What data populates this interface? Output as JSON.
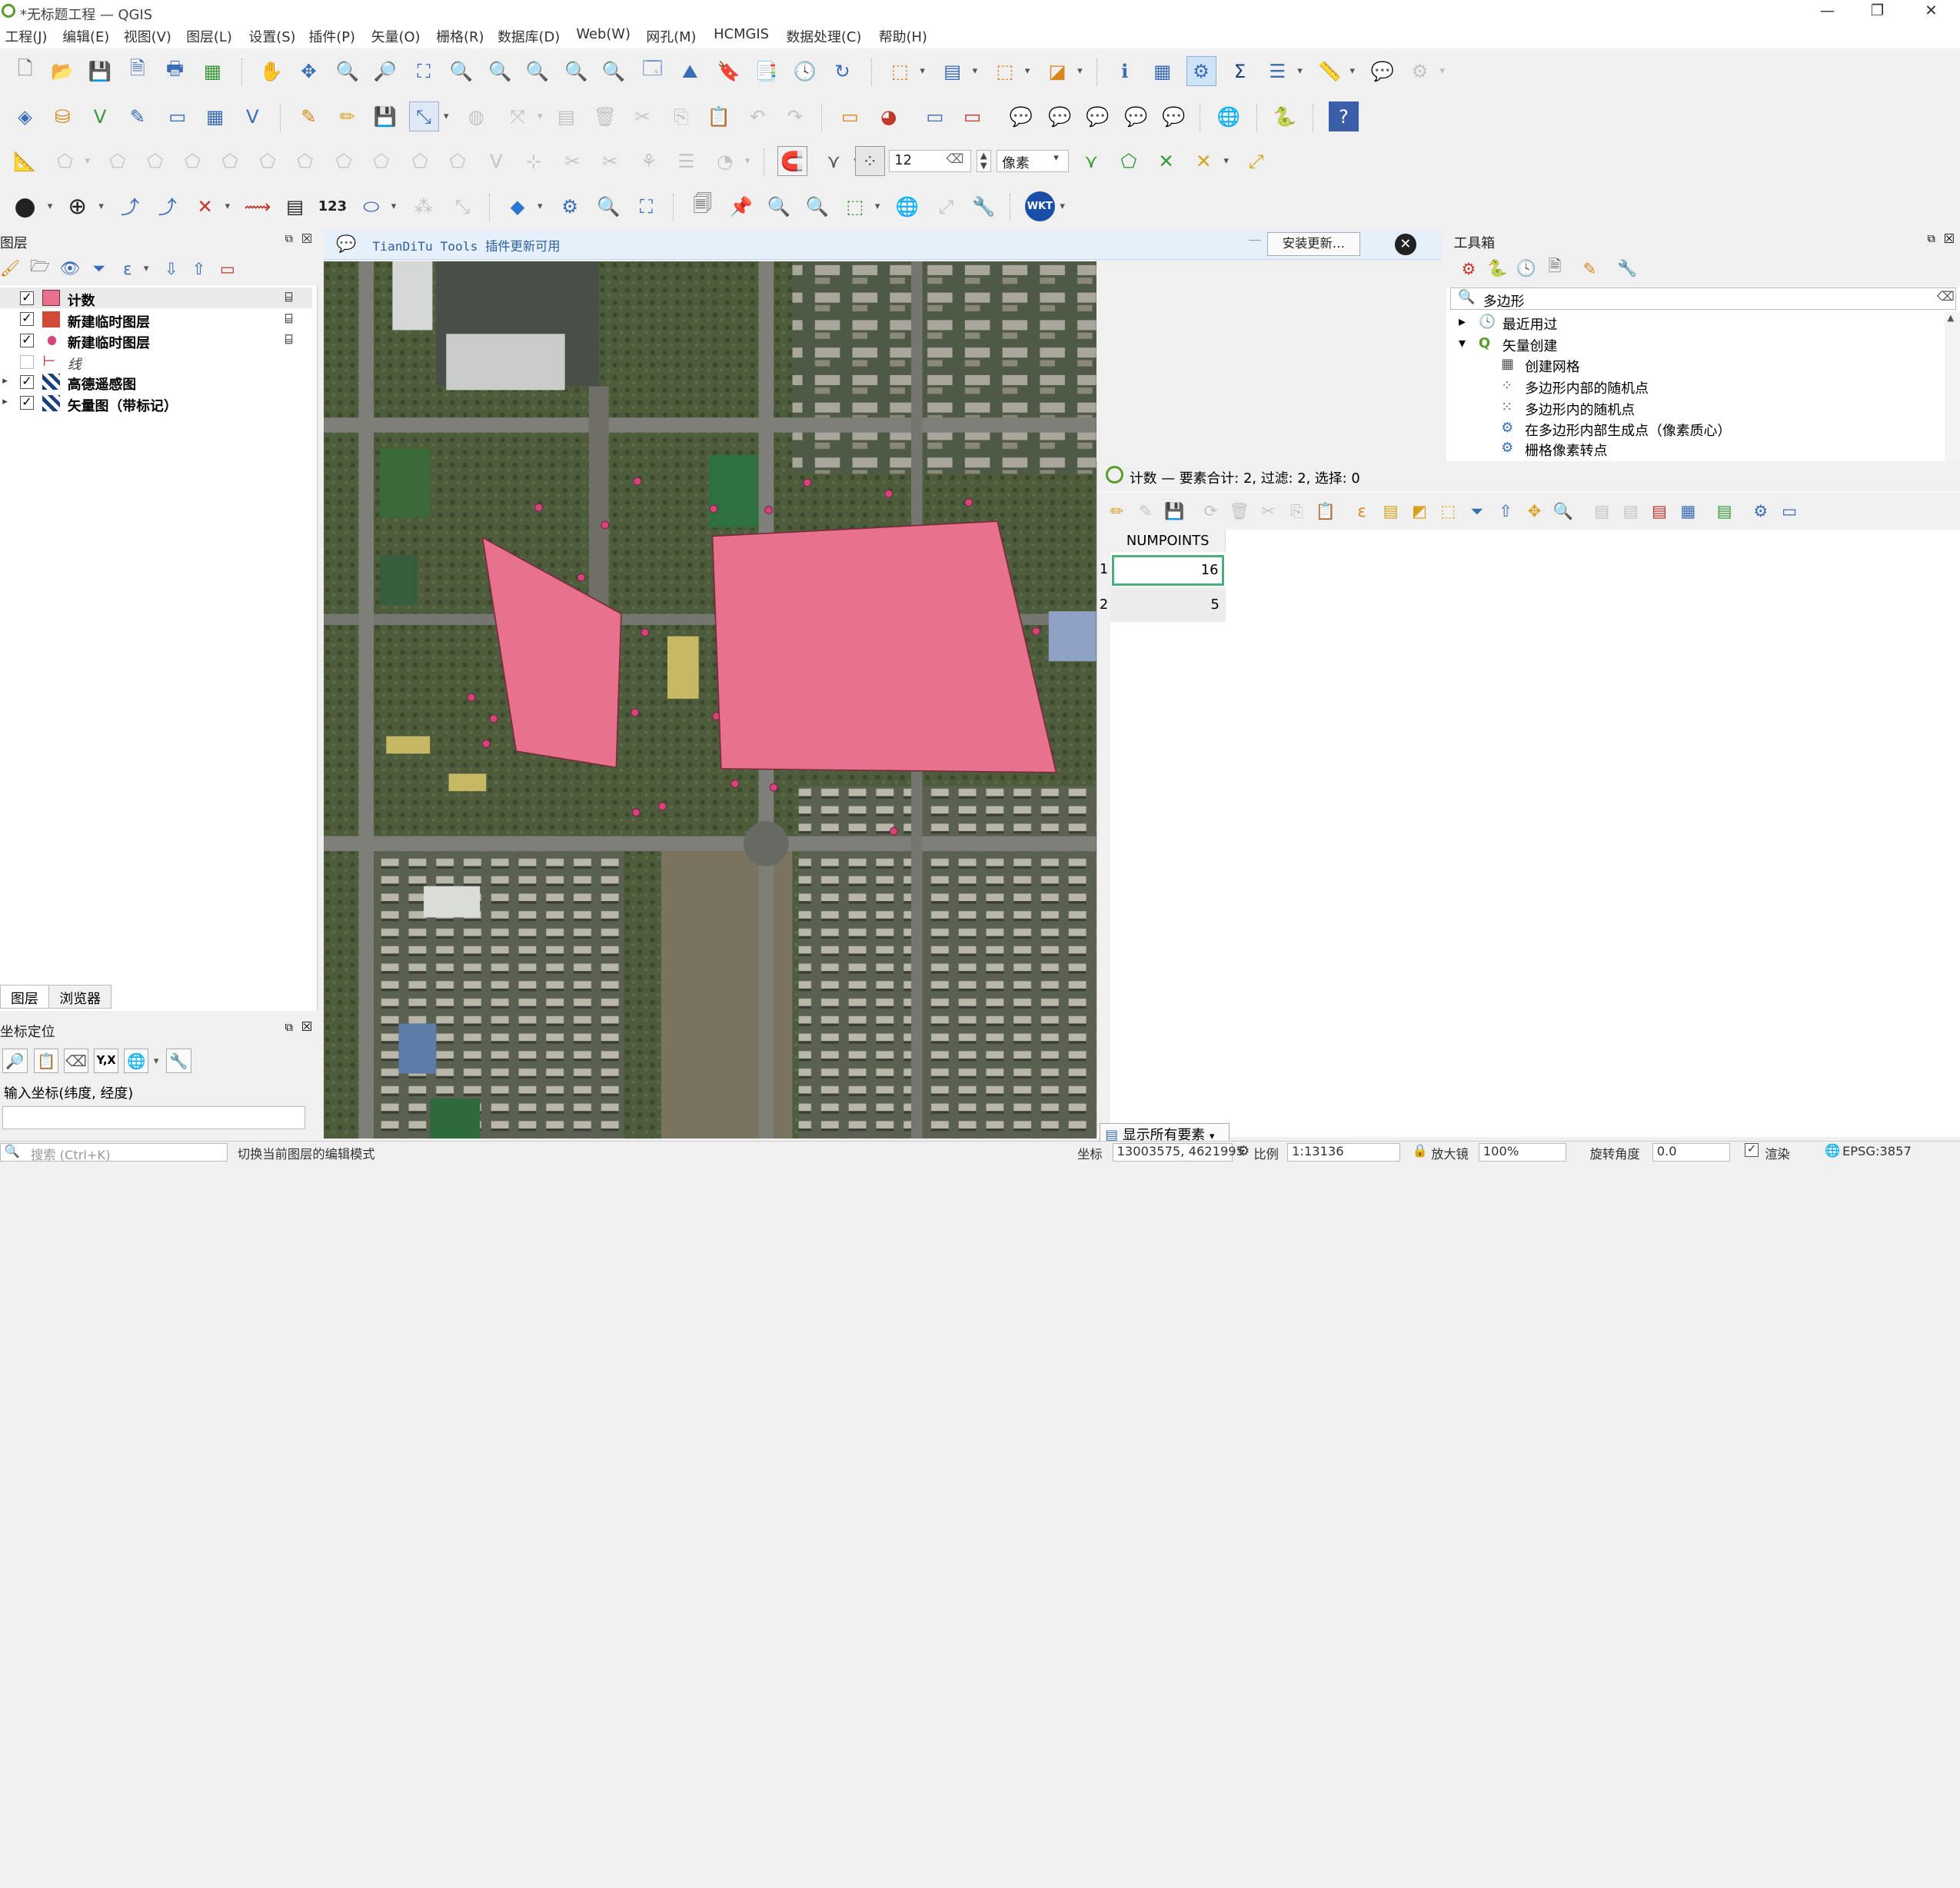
{
  "window": {
    "title": "*无标题工程 — QGIS",
    "minimize": "—",
    "maximize": "❐",
    "close": "✕"
  },
  "menu": [
    "工程(J)",
    "编辑(E)",
    "视图(V)",
    "图层(L)",
    "设置(S)",
    "插件(P)",
    "矢量(O)",
    "栅格(R)",
    "数据库(D)",
    "Web(W)",
    "网孔(M)",
    "HCMGIS",
    "数据处理(C)",
    "帮助(H)"
  ],
  "snapping": {
    "tolerance": "12",
    "unit": "像素"
  },
  "toolbar4": {
    "num_label": "123",
    "wkt_label": "WKT"
  },
  "layers_panel": {
    "title": "图层",
    "layers": [
      {
        "name": "计数",
        "checked": "✓",
        "color": "#e8718d"
      },
      {
        "name": "新建临时图层",
        "checked": "✓",
        "color": "#d04a36"
      },
      {
        "name": "新建临时图层",
        "checked": "✓",
        "color": "#d6457a"
      },
      {
        "name": "线",
        "checked": ""
      },
      {
        "name": "高德遥感图",
        "checked": "✓"
      },
      {
        "name": "矢量图（带标记）",
        "checked": "✓"
      }
    ],
    "tabs": [
      "图层",
      "浏览器"
    ]
  },
  "coord_panel": {
    "title": "坐标定位",
    "label": "输入坐标(纬度, 经度)",
    "yx": "Y,X",
    "value": ""
  },
  "infobar": {
    "text": "TianDiTu Tools 插件更新可用",
    "button": "安装更新…"
  },
  "toolbox": {
    "title": "工具箱",
    "search": "多边形",
    "items": [
      {
        "label": "最近用过",
        "indent": 0,
        "arrow": "▸"
      },
      {
        "label": "矢量创建",
        "indent": 0,
        "arrow": "▾"
      },
      {
        "label": "创建网格",
        "indent": 1
      },
      {
        "label": "多边形内部的随机点",
        "indent": 1
      },
      {
        "label": "多边形内的随机点",
        "indent": 1
      },
      {
        "label": "在多边形内部生成点（像素质心）",
        "indent": 1
      },
      {
        "label": "栅格像素转点",
        "indent": 1
      }
    ]
  },
  "attribute_table": {
    "title": "计数 — 要素合计: 2, 过滤: 2, 选择: 0",
    "column": "NUMPOINTS",
    "rows": [
      {
        "id": "1",
        "value": "16"
      },
      {
        "id": "2",
        "value": "5"
      }
    ],
    "show_all": "显示所有要素"
  },
  "statusbar": {
    "search_placeholder": "搜索 (Ctrl+K)",
    "message": "切换当前图层的编辑模式",
    "coord_label": "坐标",
    "coord": "13003575, 4621995",
    "scale_label": "比例",
    "scale": "1:13136",
    "zoom_label": "放大镜",
    "zoom": "100%",
    "rotation_label": "旋转角度",
    "rotation": "0.0",
    "render": "渲染",
    "crs": "EPSG:3857"
  },
  "colors": {
    "polygon_fill": "#e8718d",
    "polygon_stroke": "#7a2a3c",
    "point": "#d6457a",
    "accent": "#3a6db5"
  }
}
